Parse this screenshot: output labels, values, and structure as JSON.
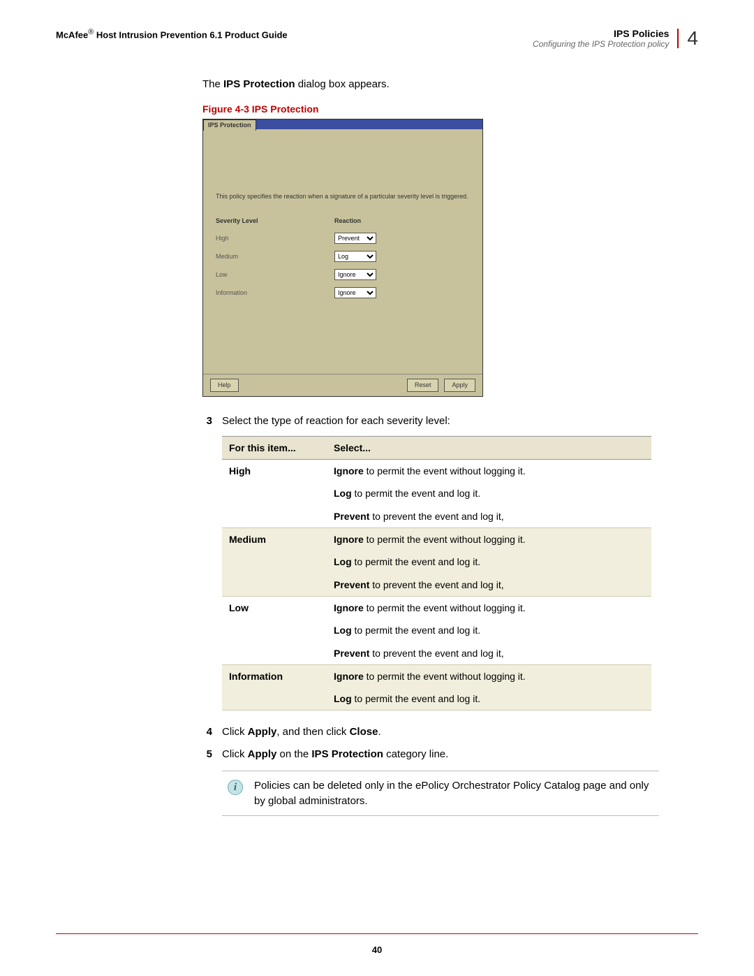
{
  "header": {
    "brand": "McAfee",
    "reg": "®",
    "guide_title": "Host Intrusion Prevention 6.1 Product Guide",
    "section": "IPS Policies",
    "chapter_num": "4",
    "subtitle": "Configuring the IPS Protection policy"
  },
  "intro": {
    "pre": "The ",
    "bold": "IPS Protection",
    "post": " dialog box appears."
  },
  "figure_caption": "Figure 4-3  IPS Protection",
  "dialog": {
    "tab": "IPS Protection",
    "desc": "This policy specifies the reaction when a signature of a particular severity level is triggered.",
    "col1": "Severity Level",
    "col2": "Reaction",
    "rows": [
      {
        "level": "High",
        "value": "Prevent"
      },
      {
        "level": "Medium",
        "value": "Log"
      },
      {
        "level": "Low",
        "value": "Ignore"
      },
      {
        "level": "Information",
        "value": "Ignore"
      }
    ],
    "options": [
      "Prevent",
      "Log",
      "Ignore"
    ],
    "help": "Help",
    "reset": "Reset",
    "apply": "Apply"
  },
  "step3": {
    "num": "3",
    "text": "Select the type of reaction for each severity level:"
  },
  "table": {
    "h1": "For this item...",
    "h2": "Select...",
    "rows": [
      {
        "item": "High",
        "lines": [
          {
            "b": "Ignore",
            "t": " to permit the event without logging it."
          },
          {
            "b": "Log",
            "t": " to permit the event and log it."
          },
          {
            "b": "Prevent",
            "t": " to prevent the event and log it,"
          }
        ]
      },
      {
        "item": "Medium",
        "lines": [
          {
            "b": "Ignore",
            "t": " to permit the event without logging it."
          },
          {
            "b": "Log",
            "t": " to permit the event and log it."
          },
          {
            "b": "Prevent",
            "t": " to prevent the event and log it,"
          }
        ]
      },
      {
        "item": "Low",
        "lines": [
          {
            "b": "Ignore",
            "t": " to permit the event without logging it."
          },
          {
            "b": "Log",
            "t": " to permit the event and log it."
          },
          {
            "b": "Prevent",
            "t": " to prevent the event and log it,"
          }
        ]
      },
      {
        "item": "Information",
        "lines": [
          {
            "b": "Ignore",
            "t": " to permit the event without logging it."
          },
          {
            "b": "Log",
            "t": " to permit the event and log it."
          }
        ]
      }
    ]
  },
  "step4": {
    "num": "4",
    "pre": "Click ",
    "b1": "Apply",
    "mid": ", and then click ",
    "b2": "Close",
    "post": "."
  },
  "step5": {
    "num": "5",
    "pre": "Click ",
    "b1": "Apply",
    "mid": " on the ",
    "b2": "IPS Protection",
    "post": " category line."
  },
  "note": "Policies can be deleted only in the ePolicy Orchestrator Policy Catalog page and only by global administrators.",
  "page_number": "40"
}
